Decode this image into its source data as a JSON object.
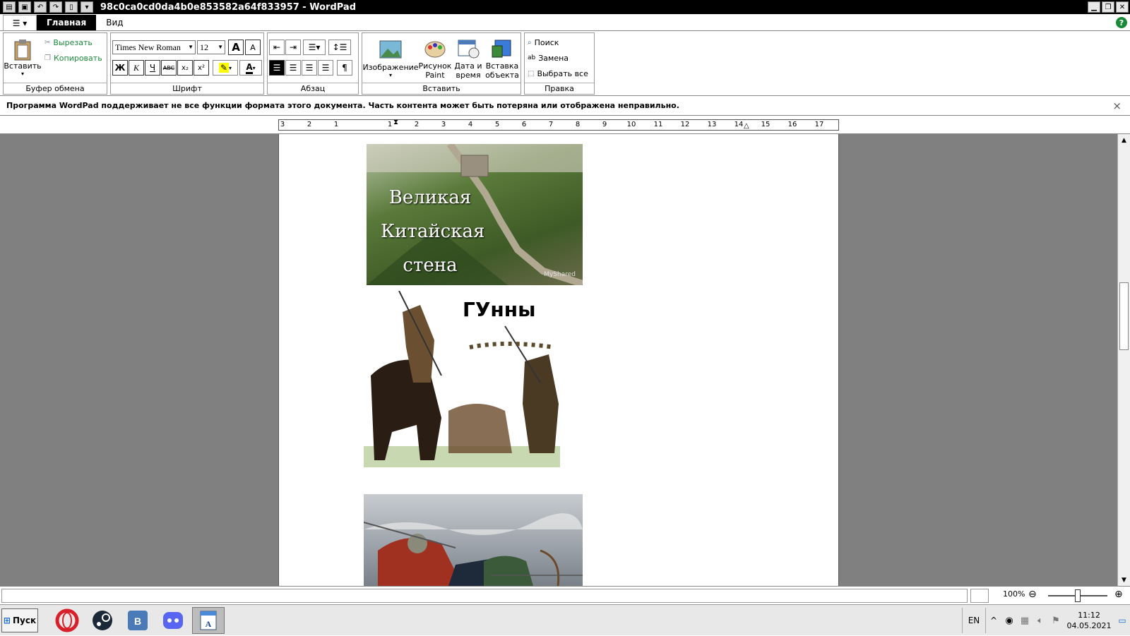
{
  "window": {
    "title": "98c0ca0cd0da4b0e853582a64f833957 - WordPad",
    "controls": [
      "minimize",
      "restore",
      "close"
    ]
  },
  "tabs": {
    "home": "Главная",
    "view": "Вид"
  },
  "ribbon": {
    "clipboard": {
      "label": "Буфер обмена",
      "paste": "Вставить",
      "cut": "Вырезать",
      "copy": "Копировать"
    },
    "font": {
      "label": "Шрифт",
      "family": "Times New Roman",
      "size": "12",
      "bold": "Ж",
      "italic": "К",
      "underline": "Ч",
      "strike": "ABC",
      "sub": "x₂",
      "sup": "x²"
    },
    "paragraph": {
      "label": "Абзац"
    },
    "insert": {
      "label": "Вставить",
      "image": "Изображение",
      "paint_line1": "Рисунок",
      "paint_line2": "Paint",
      "datetime_line1": "Дата и",
      "datetime_line2": "время",
      "object_line1": "Вставка",
      "object_line2": "объекта"
    },
    "editing": {
      "label": "Правка",
      "find": "Поиск",
      "replace": "Замена",
      "select_all": "Выбрать все"
    }
  },
  "infobar": {
    "message": "Программа WordPad поддерживает не все функции формата этого документа. Часть контента может быть потеряна или отображена неправильно.",
    "close": "×"
  },
  "ruler": {
    "marks": [
      "3",
      "2",
      "1",
      "1",
      "2",
      "3",
      "4",
      "5",
      "6",
      "7",
      "8",
      "9",
      "10",
      "11",
      "12",
      "13",
      "14",
      "15",
      "16",
      "17"
    ]
  },
  "document": {
    "image1_caption_lines": [
      "Великая",
      "Китайская",
      "стена"
    ],
    "image1_watermark": "MyShared",
    "image2_title": "ГУнны"
  },
  "statusbar": {
    "zoom": "100%"
  },
  "taskbar": {
    "start": "Пуск",
    "lang": "EN",
    "time": "11:12",
    "date": "04.05.2021"
  },
  "colors": {
    "titlebar": "#000000",
    "accent_green": "#1a8a3a",
    "doc_bg": "#808080"
  }
}
